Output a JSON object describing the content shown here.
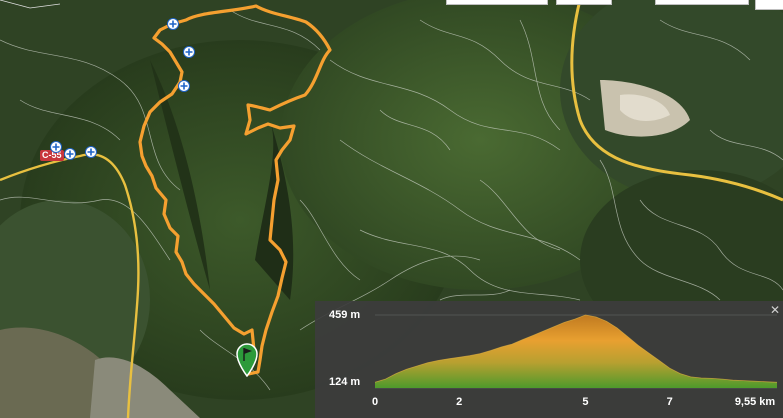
{
  "map": {
    "road_badge": "C-55",
    "poi_icon": "pedestrian-crossing-icon",
    "start_icon": "green-flag-pin-icon",
    "route_color": "#f5a030",
    "road_color": "#e8c040"
  },
  "profile": {
    "y_max_label": "459 m",
    "y_min_label": "124 m",
    "x_ticks": [
      "0",
      "2",
      "5",
      "7",
      "9,55 km"
    ],
    "close_icon": "close-x-icon",
    "gradient": [
      "#c07a20",
      "#e8a030",
      "#b8a030",
      "#4e9a2c"
    ]
  },
  "chart_data": {
    "type": "area",
    "title": "",
    "xlabel": "",
    "ylabel": "",
    "x_unit": "km",
    "y_unit": "m",
    "ylim": [
      124,
      459
    ],
    "xlim": [
      0,
      9.55
    ],
    "x": [
      0,
      0.25,
      0.5,
      0.75,
      1.0,
      1.25,
      1.5,
      1.75,
      2.0,
      2.25,
      2.5,
      2.75,
      3.0,
      3.25,
      3.5,
      3.75,
      4.0,
      4.25,
      4.5,
      4.75,
      5.0,
      5.25,
      5.5,
      5.75,
      6.0,
      6.25,
      6.5,
      6.75,
      7.0,
      7.25,
      7.5,
      7.75,
      8.0,
      8.25,
      8.5,
      8.75,
      9.0,
      9.25,
      9.55
    ],
    "series": [
      {
        "values": [
          150,
          165,
          190,
          210,
          225,
          240,
          250,
          258,
          265,
          272,
          282,
          296,
          312,
          325,
          345,
          365,
          385,
          405,
          425,
          440,
          459,
          450,
          430,
          400,
          360,
          320,
          285,
          250,
          215,
          190,
          175,
          170,
          168,
          165,
          160,
          158,
          155,
          153,
          150
        ]
      }
    ]
  }
}
